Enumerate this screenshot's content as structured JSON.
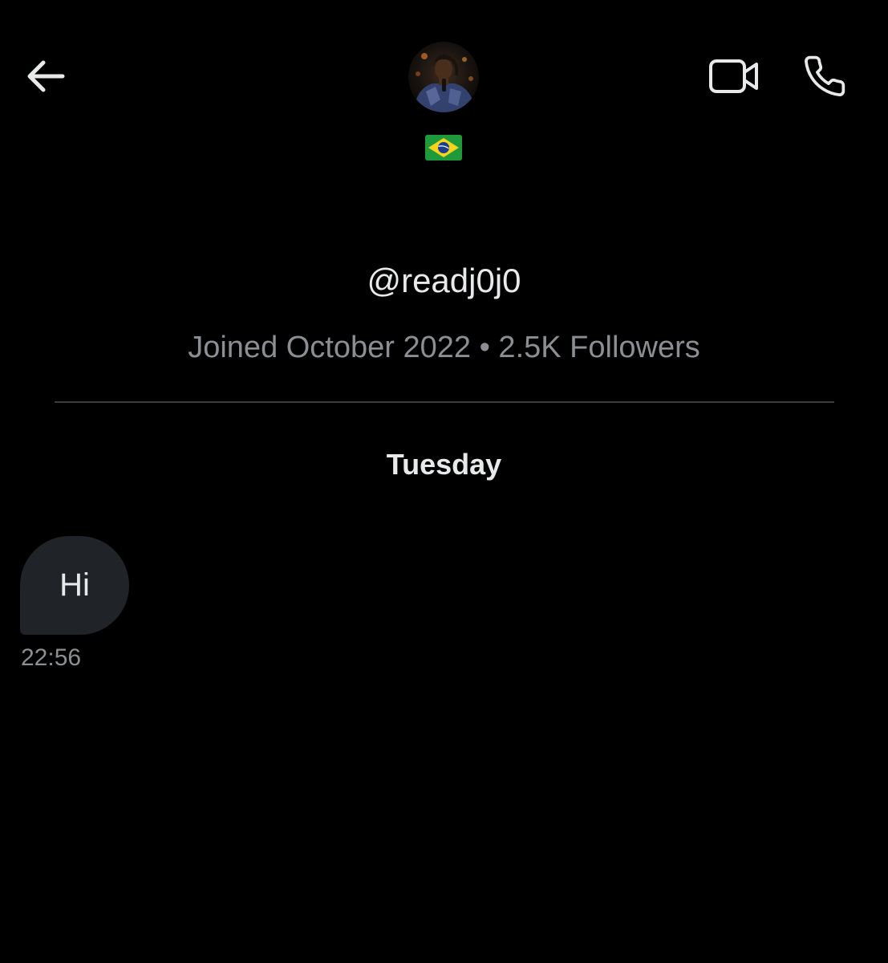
{
  "header": {
    "back_icon": "arrow-left-icon",
    "video_icon": "video-camera-icon",
    "call_icon": "phone-icon",
    "avatar": "profile-photo",
    "flag_icon": "brazil-flag-icon"
  },
  "profile": {
    "handle": "@readj0j0",
    "meta": "Joined October 2022 • 2.5K Followers"
  },
  "conversation": {
    "day_label": "Tuesday",
    "messages": [
      {
        "text": "Hi",
        "time": "22:56"
      }
    ]
  },
  "colors": {
    "background": "#000000",
    "primary_text": "#e7e9ea",
    "secondary_text": "#8b8f93",
    "bubble": "#202327",
    "divider": "#3a3d40"
  }
}
